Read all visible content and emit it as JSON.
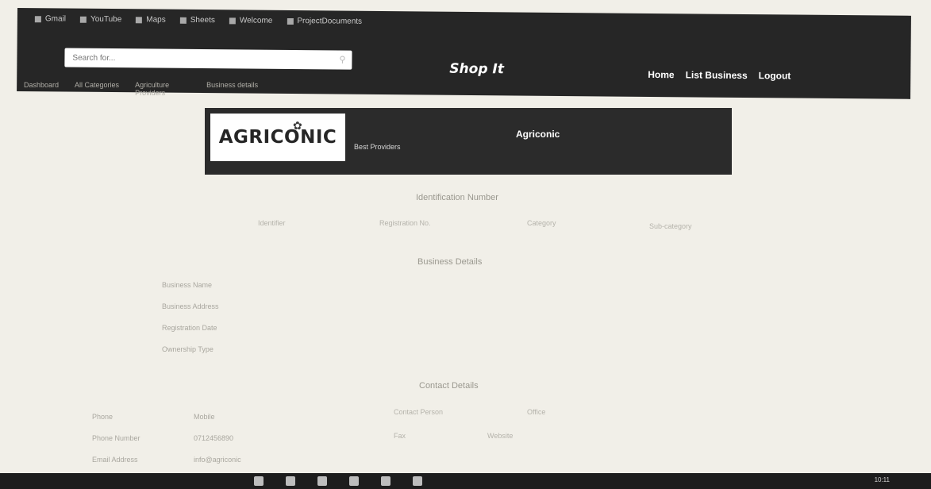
{
  "bookmarks": [
    {
      "label": "Gmail",
      "icon": "mail-icon"
    },
    {
      "label": "YouTube",
      "icon": "youtube-icon"
    },
    {
      "label": "Maps",
      "icon": "maps-icon"
    },
    {
      "label": "Sheets",
      "icon": "sheets-icon"
    },
    {
      "label": "Welcome",
      "icon": "page-icon"
    },
    {
      "label": "ProjectDocuments",
      "icon": "folder-icon"
    }
  ],
  "search": {
    "placeholder": "Search for..."
  },
  "brand": "Shop It",
  "nav": {
    "home": "Home",
    "list_business": "List Business",
    "logout": "Logout"
  },
  "breadcrumbs": [
    "Dashboard",
    "All Categories",
    "Agriculture Providers",
    "Business details"
  ],
  "banner": {
    "logo_text": "AGRICONIC",
    "tagline": "Best Providers",
    "name": "Agriconic"
  },
  "sections": {
    "identification": "Identification Number",
    "business": "Business Details",
    "contact": "Contact Details"
  },
  "id_fields": [
    "Identifier",
    "Registration No.",
    "Category",
    "Sub-category"
  ],
  "business_fields": [
    "Business Name",
    "Business Address",
    "Registration Date",
    "Ownership Type"
  ],
  "contact_fields": [
    {
      "label": "Phone",
      "value": "Mobile"
    },
    {
      "label": "Phone Number",
      "value": "0712456890"
    },
    {
      "label": "Email Address",
      "value": "info@agriconic"
    }
  ],
  "contact_right": [
    "Contact Person",
    "Office",
    "Fax",
    "Website"
  ],
  "taskbar": {
    "clock": "10:11"
  }
}
